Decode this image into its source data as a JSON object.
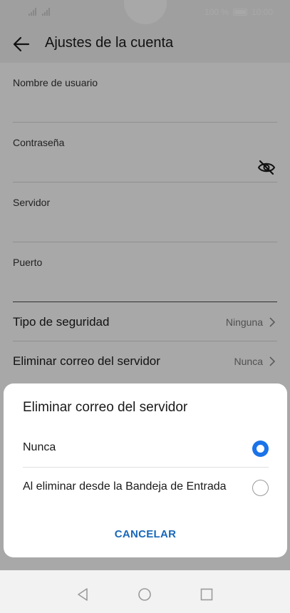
{
  "status_bar": {
    "battery_text": "100 %",
    "time": "10:00"
  },
  "header": {
    "title": "Ajustes de la cuenta",
    "back_icon": "arrow-left-icon"
  },
  "fields": [
    {
      "label": "Nombre de usuario"
    },
    {
      "label": "Contraseña",
      "icon": "eye-off-icon"
    },
    {
      "label": "Servidor"
    },
    {
      "label": "Puerto"
    }
  ],
  "settings": [
    {
      "label": "Tipo de seguridad",
      "value": "Ninguna"
    },
    {
      "label": "Eliminar correo del servidor",
      "value": "Nunca"
    }
  ],
  "dialog": {
    "title": "Eliminar correo del servidor",
    "options": [
      {
        "label": "Nunca",
        "selected": true
      },
      {
        "label": "Al eliminar desde la Bandeja de Entrada",
        "selected": false
      }
    ],
    "cancel_label": "CANCELAR"
  },
  "colors": {
    "accent": "#1a73e8",
    "cancel_text": "#1967b8"
  },
  "navbar": {
    "icons": [
      "back-triangle-icon",
      "home-circle-icon",
      "recents-square-icon"
    ]
  }
}
